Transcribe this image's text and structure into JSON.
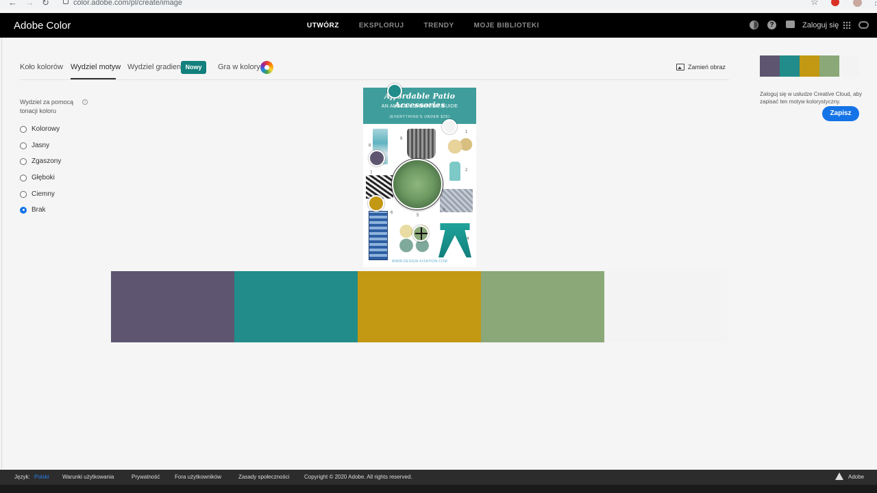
{
  "browser": {
    "url": "color.adobe.com/pl/create/image"
  },
  "header": {
    "app_title": "Adobe Color",
    "nav": [
      "UTWÓRZ",
      "EKSPLORUJ",
      "TRENDY",
      "MOJE BIBLIOTEKI"
    ],
    "login": "Zaloguj się"
  },
  "tabs": {
    "items": [
      "Koło kolorów",
      "Wydziel motyw",
      "Wydziel gradient",
      "Gra w kolory"
    ],
    "new_badge": "Nowy",
    "replace_image": "Zamień obraz"
  },
  "options": {
    "label": "Wydziel za pomocą tonacji koloru",
    "info": "i",
    "moods": [
      "Kolorowy",
      "Jasny",
      "Zgaszony",
      "Głęboki",
      "Ciemny",
      "Brak"
    ],
    "selected": "Brak"
  },
  "poster": {
    "title": "Affordable Patio Accessories",
    "subtitle": "AN AMAZON SHOPPING GUIDE",
    "subtitle2": "(EVERYTHING'S UNDER $25)",
    "footer": "WWW.DESIGN-FIXATION.COM",
    "numbers": [
      "1",
      "2",
      "3",
      "4",
      "5",
      "6",
      "7",
      "8",
      "9"
    ]
  },
  "palette": {
    "colors": [
      "#5e5670",
      "#218c8a",
      "#c39812",
      "#8aa878",
      "#f3f3f3"
    ]
  },
  "save_panel": {
    "message": "Zaloguj się w usłudze Creative Cloud, aby zapisać ten motyw kolorystyczny.",
    "button": "Zapisz"
  },
  "footer": {
    "lang_label": "Język:",
    "lang_value": "Polski",
    "links": [
      "Warunki użytkowania",
      "Prywatność",
      "Fora użytkowników",
      "Zasady społeczności"
    ],
    "copyright": "Copyright © 2020 Adobe. All rights reserved.",
    "brand": "Adobe"
  }
}
